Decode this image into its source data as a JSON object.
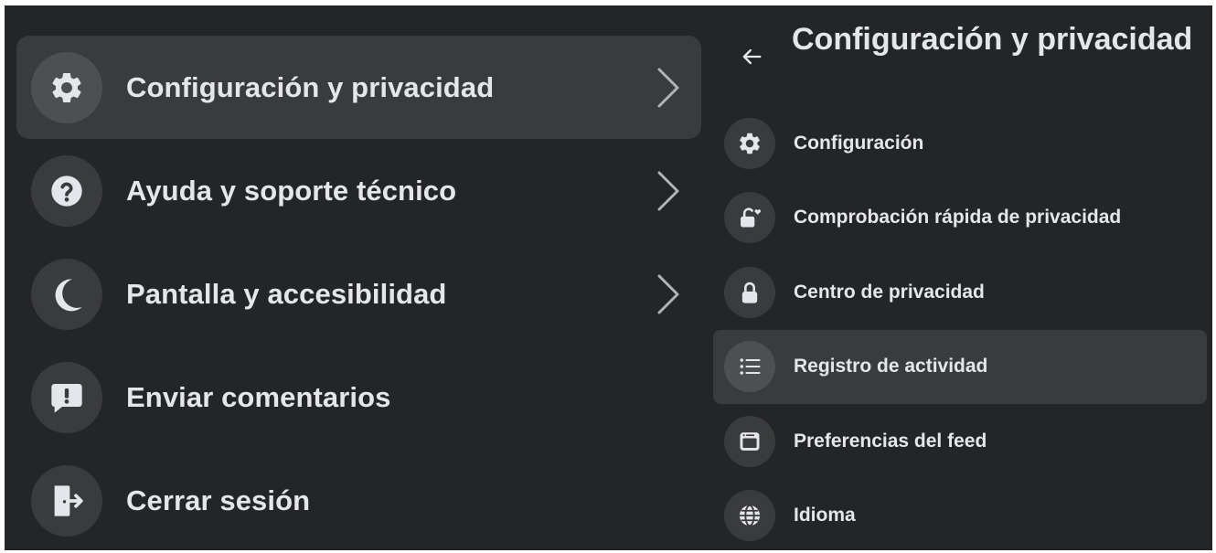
{
  "left_menu": {
    "items": [
      {
        "label": "Configuración y privacidad",
        "icon": "gear-icon",
        "has_chevron": true,
        "active": true
      },
      {
        "label": "Ayuda y soporte técnico",
        "icon": "help-icon",
        "has_chevron": true,
        "active": false
      },
      {
        "label": "Pantalla y accesibilidad",
        "icon": "moon-icon",
        "has_chevron": true,
        "active": false
      },
      {
        "label": "Enviar comentarios",
        "icon": "feedback-icon",
        "has_chevron": false,
        "active": false
      },
      {
        "label": "Cerrar sesión",
        "icon": "logout-icon",
        "has_chevron": false,
        "active": false
      }
    ]
  },
  "right_panel": {
    "back_icon": "arrow-left-icon",
    "title": "Configuración y privacidad",
    "items": [
      {
        "label": "Configuración",
        "icon": "gear-icon",
        "active": false
      },
      {
        "label": "Comprobación rápida de privacidad",
        "icon": "lock-heart-icon",
        "active": false
      },
      {
        "label": "Centro de privacidad",
        "icon": "lock-icon",
        "active": false
      },
      {
        "label": "Registro de actividad",
        "icon": "list-icon",
        "active": true
      },
      {
        "label": "Preferencias del feed",
        "icon": "feed-icon",
        "active": false
      },
      {
        "label": "Idioma",
        "icon": "globe-icon",
        "active": false
      }
    ]
  },
  "colors": {
    "background": "#242526",
    "hover": "#3a3b3c",
    "text": "#e4e6eb"
  }
}
